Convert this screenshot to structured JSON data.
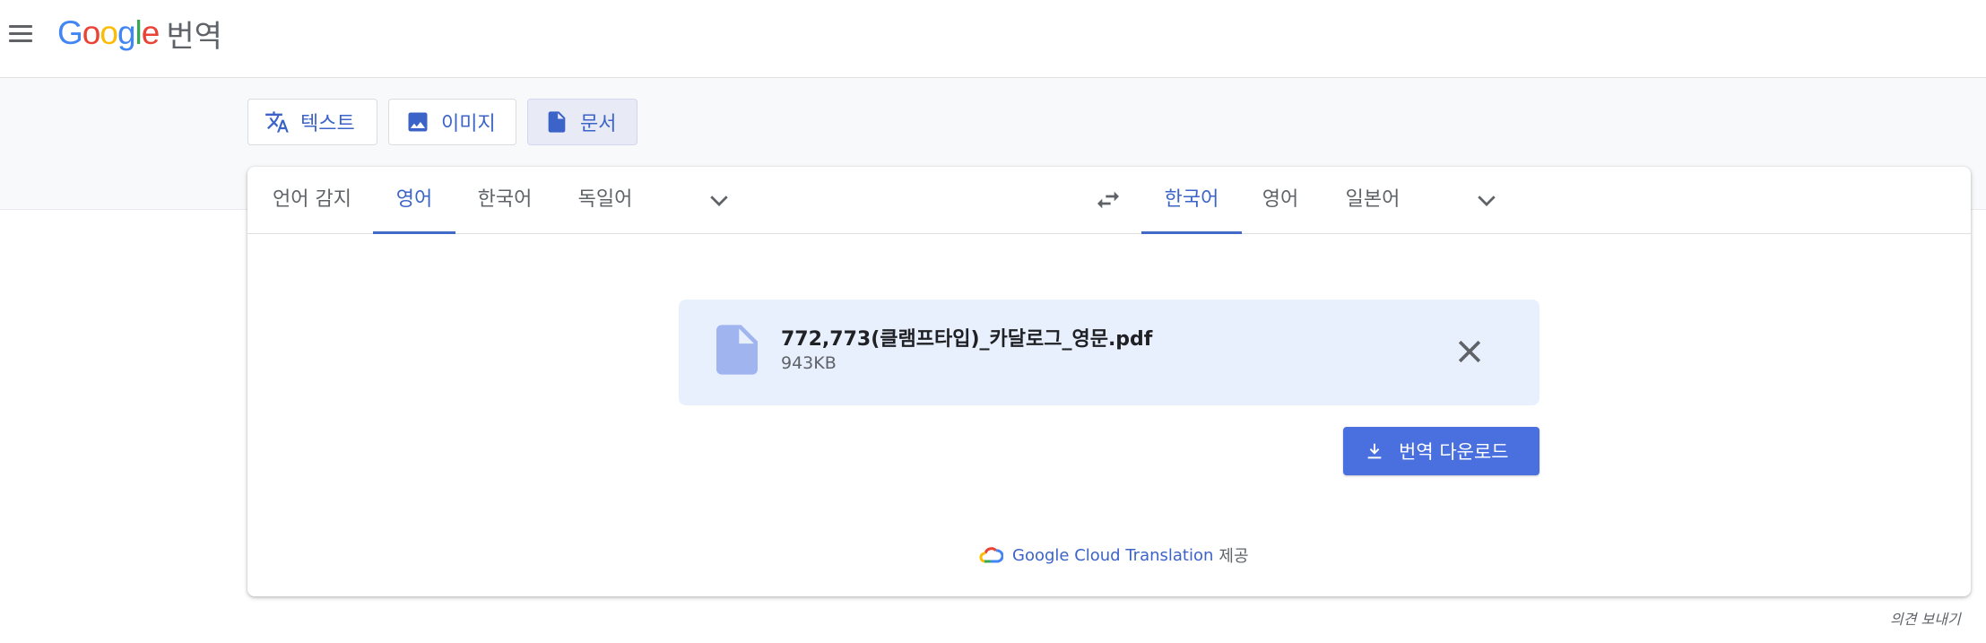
{
  "header": {
    "logo_letters": [
      "G",
      "o",
      "o",
      "g",
      "l",
      "e"
    ],
    "logo_colors": [
      "#4285F4",
      "#EA4335",
      "#FBBC05",
      "#4285F4",
      "#34A853",
      "#EA4335"
    ],
    "product": "번역"
  },
  "modes": [
    {
      "label": "텍스트",
      "icon": "translate-icon"
    },
    {
      "label": "이미지",
      "icon": "image-icon"
    },
    {
      "label": "문서",
      "icon": "document-icon",
      "active": true
    }
  ],
  "source_langs": {
    "tabs": [
      "언어 감지",
      "영어",
      "한국어",
      "독일어"
    ],
    "active": "영어"
  },
  "target_langs": {
    "tabs": [
      "한국어",
      "영어",
      "일본어"
    ],
    "active": "한국어"
  },
  "file": {
    "name": "772,773(클램프타입)_카달로그_영문.pdf",
    "size": "943KB"
  },
  "download": {
    "label": "번역 다운로드"
  },
  "credit": {
    "service": "Google Cloud Translation",
    "provided": "제공"
  },
  "feedback": "의견 보내기",
  "colors": {
    "accent": "#4a6fde",
    "active_text": "#3c64c8",
    "file_bg": "#e8f0fe"
  }
}
